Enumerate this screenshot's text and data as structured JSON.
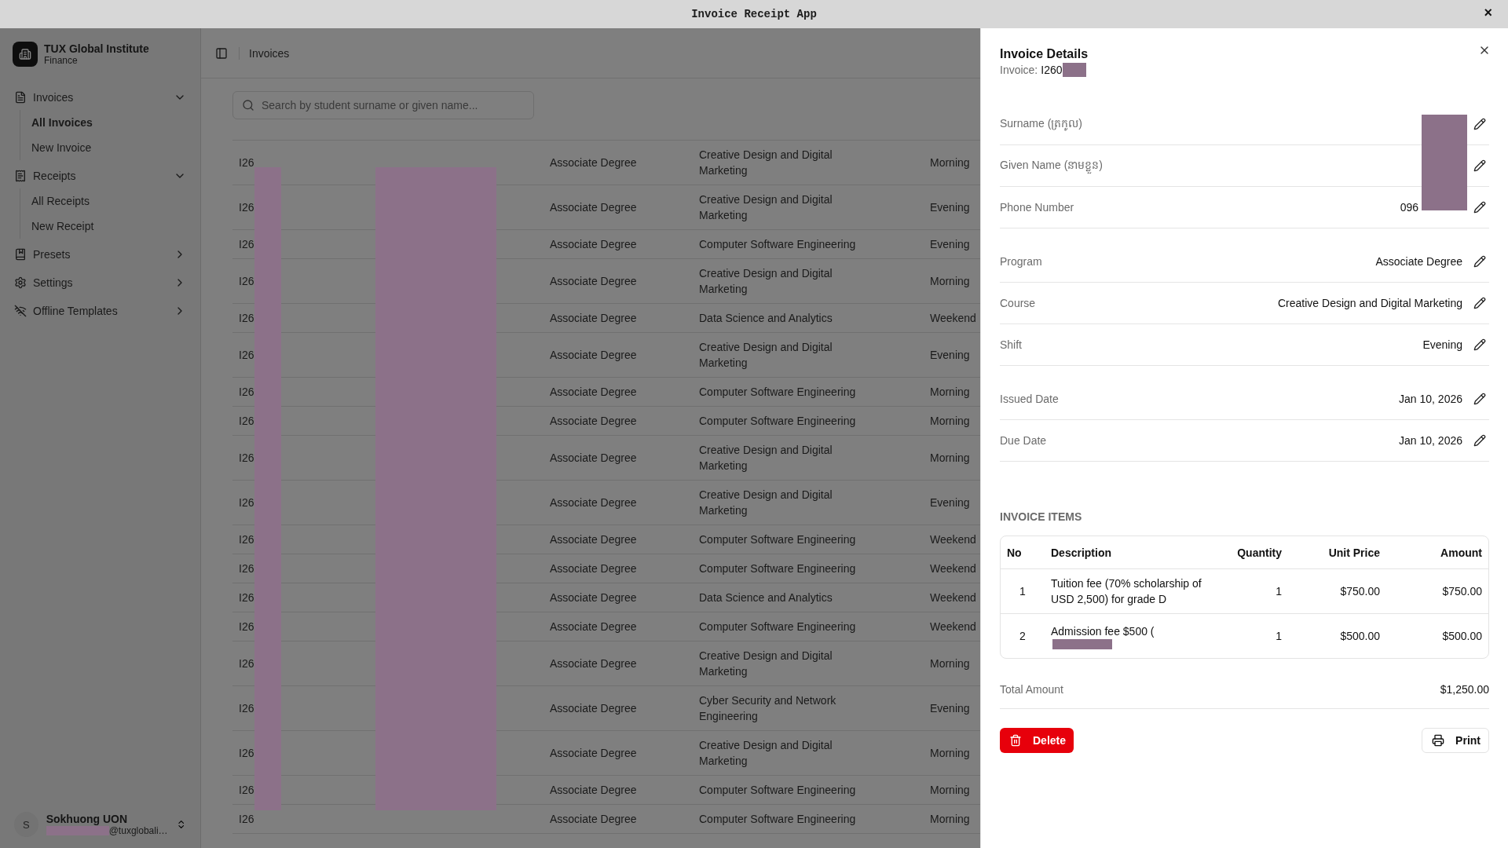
{
  "window": {
    "title": "Invoice Receipt App",
    "close": "×"
  },
  "sidebar": {
    "org": {
      "name": "TUX Global Institute",
      "subtitle": "Finance"
    },
    "items": [
      {
        "label": "Invoices",
        "expanded": true,
        "children": [
          {
            "label": "All Invoices",
            "selected": true
          },
          {
            "label": "New Invoice",
            "selected": false
          }
        ]
      },
      {
        "label": "Receipts",
        "expanded": true,
        "children": [
          {
            "label": "All Receipts",
            "selected": false
          },
          {
            "label": "New Receipt",
            "selected": false
          }
        ]
      },
      {
        "label": "Presets",
        "expanded": false
      },
      {
        "label": "Settings",
        "expanded": false
      },
      {
        "label": "Offline Templates",
        "expanded": false
      }
    ],
    "user": {
      "initial": "S",
      "name": "Sokhuong UON",
      "email": "@tuxglobali…",
      "email_redacted": true
    }
  },
  "topbar": {
    "breadcrumb": "Invoices"
  },
  "search": {
    "placeholder": "Search by student surname or given name..."
  },
  "table": {
    "redacted": true,
    "rows": [
      {
        "id": "I26",
        "program": "Associate Degree",
        "course": "Creative Design and Digital Marketing",
        "shift": "Morning"
      },
      {
        "id": "I26",
        "program": "Associate Degree",
        "course": "Creative Design and Digital Marketing",
        "shift": "Evening"
      },
      {
        "id": "I26",
        "program": "Associate Degree",
        "course": "Computer Software Engineering",
        "shift": "Evening"
      },
      {
        "id": "I26",
        "program": "Associate Degree",
        "course": "Creative Design and Digital Marketing",
        "shift": "Morning"
      },
      {
        "id": "I26",
        "program": "Associate Degree",
        "course": "Data Science and Analytics",
        "shift": "Weekend"
      },
      {
        "id": "I26",
        "program": "Associate Degree",
        "course": "Creative Design and Digital Marketing",
        "shift": "Evening"
      },
      {
        "id": "I26",
        "program": "Associate Degree",
        "course": "Computer Software Engineering",
        "shift": "Morning"
      },
      {
        "id": "I26",
        "program": "Associate Degree",
        "course": "Computer Software Engineering",
        "shift": "Morning"
      },
      {
        "id": "I26",
        "program": "Associate Degree",
        "course": "Creative Design and Digital Marketing",
        "shift": "Morning"
      },
      {
        "id": "I26",
        "program": "Associate Degree",
        "course": "Creative Design and Digital Marketing",
        "shift": "Evening"
      },
      {
        "id": "I26",
        "program": "Associate Degree",
        "course": "Computer Software Engineering",
        "shift": "Weekend"
      },
      {
        "id": "I26",
        "program": "Associate Degree",
        "course": "Computer Software Engineering",
        "shift": "Weekend"
      },
      {
        "id": "I26",
        "program": "Associate Degree",
        "course": "Data Science and Analytics",
        "shift": "Weekend"
      },
      {
        "id": "I26",
        "program": "Associate Degree",
        "course": "Computer Software Engineering",
        "shift": "Weekend"
      },
      {
        "id": "I26",
        "program": "Associate Degree",
        "course": "Creative Design and Digital Marketing",
        "shift": "Morning"
      },
      {
        "id": "I26",
        "program": "Associate Degree",
        "course": "Cyber Security and Network Engineering",
        "shift": "Evening"
      },
      {
        "id": "I26",
        "program": "Associate Degree",
        "course": "Creative Design and Digital Marketing",
        "shift": "Morning"
      },
      {
        "id": "I26",
        "program": "Associate Degree",
        "course": "Computer Software Engineering",
        "shift": "Morning"
      },
      {
        "id": "I26",
        "program": "Associate Degree",
        "course": "Computer Software Engineering",
        "shift": "Morning"
      }
    ]
  },
  "details": {
    "title": "Invoice Details",
    "invoice_label": "Invoice:",
    "invoice_id": "I260",
    "invoice_redacted": true,
    "field_groups": [
      {
        "redacted": true,
        "fields": [
          {
            "label": "Surname (ត្រកូល)"
          },
          {
            "label": "Given Name (នាមខ្លួន)"
          },
          {
            "label": "Phone Number",
            "value": "096"
          }
        ]
      },
      {
        "fields": [
          {
            "label": "Program",
            "value": "Associate Degree"
          },
          {
            "label": "Course",
            "value": "Creative Design and Digital Marketing"
          },
          {
            "label": "Shift",
            "value": "Evening"
          }
        ]
      },
      {
        "fields": [
          {
            "label": "Issued Date",
            "value": "Jan 10, 2026"
          },
          {
            "label": "Due Date",
            "value": "Jan 10, 2026"
          }
        ]
      }
    ],
    "items_heading": "INVOICE ITEMS",
    "items": {
      "columns": [
        "No",
        "Description",
        "Quantity",
        "Unit Price",
        "Amount"
      ],
      "rows": [
        {
          "no": "1",
          "description": "Tuition fee (70% scholarship of USD 2,500) for grade D",
          "quantity": "1",
          "unit_price": "$750.00",
          "amount": "$750.00"
        },
        {
          "no": "2",
          "description": "Admission fee $500 (",
          "redacted": true,
          "quantity": "1",
          "unit_price": "$500.00",
          "amount": "$500.00"
        }
      ]
    },
    "total": {
      "label": "Total Amount",
      "value": "$1,250.00"
    },
    "buttons": {
      "delete": "Delete",
      "print": "Print"
    }
  }
}
